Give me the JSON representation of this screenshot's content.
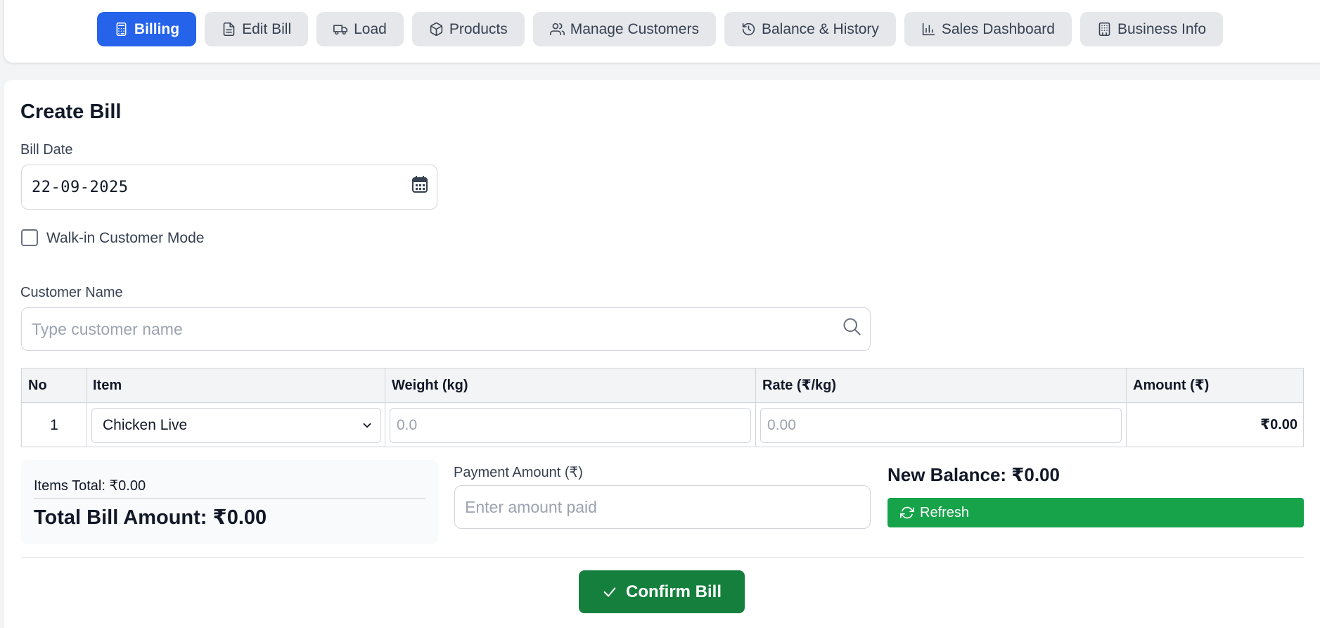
{
  "nav": {
    "tabs": [
      {
        "label": "Billing",
        "icon": "calculator-icon",
        "active": true
      },
      {
        "label": "Edit Bill",
        "icon": "file-text-icon"
      },
      {
        "label": "Load",
        "icon": "truck-icon"
      },
      {
        "label": "Products",
        "icon": "package-icon"
      },
      {
        "label": "Manage Customers",
        "icon": "users-icon"
      },
      {
        "label": "Balance & History",
        "icon": "history-icon"
      },
      {
        "label": "Sales Dashboard",
        "icon": "bar-chart-icon"
      },
      {
        "label": "Business Info",
        "icon": "building-icon"
      }
    ],
    "active_color": "#2563eb"
  },
  "form": {
    "title": "Create Bill",
    "bill_date_label": "Bill Date",
    "bill_date_value": "22-09-2025",
    "walkin_label": "Walk-in Customer Mode",
    "walkin_checked": false,
    "customer_label": "Customer Name",
    "customer_placeholder": "Type customer name"
  },
  "table": {
    "headers": [
      "No",
      "Item",
      "Weight (kg)",
      "Rate (₹/kg)",
      "Amount (₹)"
    ],
    "rows": [
      {
        "no": "1",
        "item": "Chicken Live",
        "weight_placeholder": "0.0",
        "rate_placeholder": "0.00",
        "amount": "₹0.00"
      }
    ]
  },
  "totals": {
    "items_total": "Items Total: ₹0.00",
    "total_bill": "Total Bill Amount: ₹0.00",
    "payment_label": "Payment Amount (₹)",
    "payment_placeholder": "Enter amount paid",
    "new_balance": "New Balance: ₹0.00",
    "refresh_label": "Refresh",
    "confirm_label": "Confirm Bill"
  },
  "colors": {
    "primary": "#2563eb",
    "success": "#16a34a",
    "confirm": "#15803d"
  }
}
